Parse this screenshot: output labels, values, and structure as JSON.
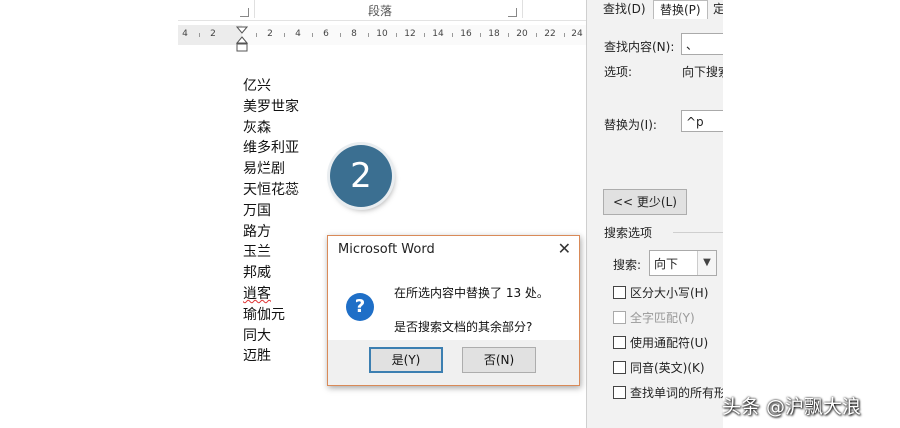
{
  "ribbon": {
    "group_label": "段落"
  },
  "ruler": {
    "numbers": [
      "4",
      "2",
      "2",
      "4",
      "6",
      "8",
      "10",
      "12",
      "14",
      "16",
      "18",
      "20",
      "22",
      "24"
    ]
  },
  "document": {
    "lines": [
      "亿兴",
      "美罗世家",
      "灰森",
      "维多利亚",
      "易烂剧",
      "天恒花蕊",
      "万国",
      "路方",
      "玉兰",
      "邦威",
      "逍客",
      "瑜伽元",
      "同大",
      "迈胜"
    ]
  },
  "step_badge": "2",
  "find_replace_pane": {
    "tabs": [
      "查找(D)",
      "替换(P)",
      "定"
    ],
    "find_label": "查找内容(N):",
    "find_value": "、",
    "options_label": "选项:",
    "options_value": "向下搜索",
    "replace_label": "替换为(I):",
    "replace_value": "^p",
    "less_button": "<< 更少(L)",
    "search_options_heading": "搜索选项",
    "search_label": "搜索:",
    "search_value": "向下",
    "checkboxes": [
      {
        "label": "区分大小写(H)",
        "enabled": true
      },
      {
        "label": "全字匹配(Y)",
        "enabled": false
      },
      {
        "label": "使用通配符(U)",
        "enabled": true
      },
      {
        "label": "同音(英文)(K)",
        "enabled": true
      },
      {
        "label": "查找单词的所有形",
        "enabled": true
      }
    ]
  },
  "dialog": {
    "title": "Microsoft Word",
    "close": "✕",
    "message1": "在所选内容中替换了 13 处。",
    "message2": "是否搜索文档的其余部分?",
    "yes_button": "是(Y)",
    "no_button": "否(N)"
  },
  "watermark": "头条 @沪飘大浪",
  "colors": {
    "badge": "#3b6f91",
    "dialog_border": "#d98a58",
    "default_button_border": "#3c7fb1",
    "info_icon": "#1f6fc7"
  }
}
